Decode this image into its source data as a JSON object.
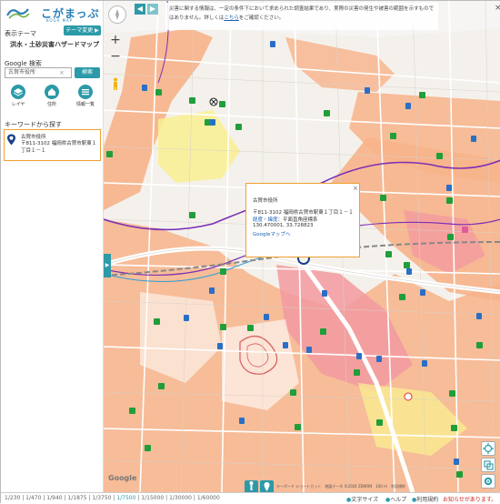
{
  "sidebar": {
    "logo_ja": "こがまっぷ",
    "logo_en": "KOGA MAP",
    "theme_label": "表示テーマ",
    "theme_change": "テーマ変更 ▶",
    "theme_name": "洪水・土砂災害ハザードマップ",
    "google_search_label": "Google 検索",
    "search_value": "古賀市役所",
    "search_clear": "×",
    "search_button": "検索",
    "tools": [
      {
        "label": "レイヤ",
        "icon": "layer-icon"
      },
      {
        "label": "住所",
        "icon": "home-icon"
      },
      {
        "label": "情報一覧",
        "icon": "list-icon"
      }
    ],
    "keyword_label": "キーワードから探す",
    "result": {
      "name": "古賀市役所",
      "address": "〒811-3102 福岡県古賀市駅東１丁目１－１"
    }
  },
  "map": {
    "notice": "災害に関する情報は、一定の条件下において求められた調査結果であり、実際の災害の発生や被害の範囲を示すものではありません。詳しくは",
    "notice_link": "こちら",
    "notice_end": "をご確認ください。",
    "notice_close": "×",
    "zoom_in": "+",
    "zoom_out": "−",
    "collapse": "◀",
    "collapse2": "▶",
    "side_tab": "▶",
    "google": "Google",
    "attribution": "キーボード ショートカット　地図データ ©2024 ZENRIN　100 m　利用規約",
    "popup": {
      "title": "古賀市役所",
      "address": "〒811-3102 福岡県古賀市駅東１丁目１－１",
      "coord_links": "経度・緯度",
      "coord_system": "：平面直角座標系",
      "coords": "130.470001, 33.728823",
      "google_maps": "Googleマップへ",
      "close": "×"
    }
  },
  "bottom": {
    "scales": [
      "1/230",
      "1/470",
      "1/940",
      "1/1875",
      "1/3750",
      "1/7500",
      "1/15000",
      "1/30000",
      "1/60000"
    ],
    "selected_scale": "1/7500",
    "font_size": "文字サイズ",
    "help": "ヘルプ",
    "terms": "利用規約",
    "announcement": "お知らせがあります。"
  },
  "colors": {
    "accent": "#2c9aa8",
    "flood_orange": "#f7b38a",
    "flood_yellow": "#f9f092",
    "flood_pink": "#f39aa0",
    "river_purple": "#7b2fb5",
    "highlight": "#f0a030"
  }
}
